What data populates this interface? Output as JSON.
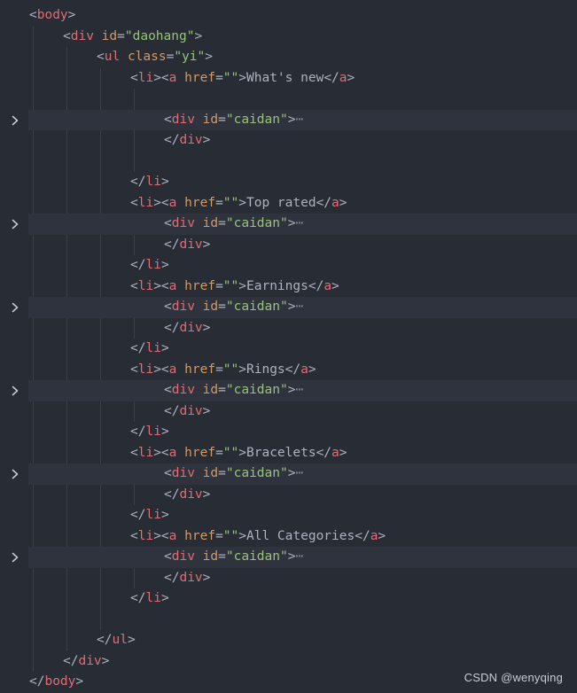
{
  "editor": {
    "watermark": "CSDN @wenyqing",
    "colors": {
      "background": "#282c34",
      "folded_line_highlight": "#2f333d",
      "tag": "#e06c75",
      "attribute": "#d19a66",
      "string": "#98c379",
      "text": "#abb2bf",
      "indent_guide": "#3b4048"
    },
    "icons": {
      "fold_marker": "chevron-right-icon"
    },
    "lines": [
      {
        "indent": 0,
        "folded": false,
        "tokens": [
          {
            "t": "punct",
            "v": "<"
          },
          {
            "t": "tag",
            "v": "body"
          },
          {
            "t": "punct",
            "v": ">"
          }
        ]
      },
      {
        "indent": 1,
        "folded": false,
        "tokens": [
          {
            "t": "punct",
            "v": "<"
          },
          {
            "t": "tag",
            "v": "div"
          },
          {
            "t": "text",
            "v": " "
          },
          {
            "t": "attr",
            "v": "id"
          },
          {
            "t": "punct",
            "v": "="
          },
          {
            "t": "str",
            "v": "\"daohang\""
          },
          {
            "t": "punct",
            "v": ">"
          }
        ]
      },
      {
        "indent": 2,
        "folded": false,
        "tokens": [
          {
            "t": "punct",
            "v": "<"
          },
          {
            "t": "tag",
            "v": "ul"
          },
          {
            "t": "text",
            "v": " "
          },
          {
            "t": "attr",
            "v": "class"
          },
          {
            "t": "punct",
            "v": "="
          },
          {
            "t": "str",
            "v": "\"yi\""
          },
          {
            "t": "punct",
            "v": ">"
          }
        ]
      },
      {
        "indent": 3,
        "folded": false,
        "tokens": [
          {
            "t": "punct",
            "v": "<"
          },
          {
            "t": "tag",
            "v": "li"
          },
          {
            "t": "punct",
            "v": "><"
          },
          {
            "t": "tag",
            "v": "a"
          },
          {
            "t": "text",
            "v": " "
          },
          {
            "t": "attr",
            "v": "href"
          },
          {
            "t": "punct",
            "v": "="
          },
          {
            "t": "str",
            "v": "\"\""
          },
          {
            "t": "punct",
            "v": ">"
          },
          {
            "t": "text",
            "v": "What's new"
          },
          {
            "t": "punct",
            "v": "</"
          },
          {
            "t": "tag",
            "v": "a"
          },
          {
            "t": "punct",
            "v": ">"
          }
        ]
      },
      {
        "indent": 0,
        "folded": false,
        "tokens": []
      },
      {
        "indent": 4,
        "folded": true,
        "tokens": [
          {
            "t": "punct",
            "v": "<"
          },
          {
            "t": "tag",
            "v": "div"
          },
          {
            "t": "text",
            "v": " "
          },
          {
            "t": "attr",
            "v": "id"
          },
          {
            "t": "punct",
            "v": "="
          },
          {
            "t": "str",
            "v": "\"caidan\""
          },
          {
            "t": "punct",
            "v": ">"
          },
          {
            "t": "ellipsis",
            "v": "⋯"
          }
        ]
      },
      {
        "indent": 4,
        "folded": false,
        "tokens": [
          {
            "t": "punct",
            "v": "</"
          },
          {
            "t": "tag",
            "v": "div"
          },
          {
            "t": "punct",
            "v": ">"
          }
        ]
      },
      {
        "indent": 0,
        "folded": false,
        "tokens": []
      },
      {
        "indent": 3,
        "folded": false,
        "tokens": [
          {
            "t": "punct",
            "v": "</"
          },
          {
            "t": "tag",
            "v": "li"
          },
          {
            "t": "punct",
            "v": ">"
          }
        ]
      },
      {
        "indent": 3,
        "folded": false,
        "tokens": [
          {
            "t": "punct",
            "v": "<"
          },
          {
            "t": "tag",
            "v": "li"
          },
          {
            "t": "punct",
            "v": "><"
          },
          {
            "t": "tag",
            "v": "a"
          },
          {
            "t": "text",
            "v": " "
          },
          {
            "t": "attr",
            "v": "href"
          },
          {
            "t": "punct",
            "v": "="
          },
          {
            "t": "str",
            "v": "\"\""
          },
          {
            "t": "punct",
            "v": ">"
          },
          {
            "t": "text",
            "v": "Top rated"
          },
          {
            "t": "punct",
            "v": "</"
          },
          {
            "t": "tag",
            "v": "a"
          },
          {
            "t": "punct",
            "v": ">"
          }
        ]
      },
      {
        "indent": 4,
        "folded": true,
        "tokens": [
          {
            "t": "punct",
            "v": "<"
          },
          {
            "t": "tag",
            "v": "div"
          },
          {
            "t": "text",
            "v": " "
          },
          {
            "t": "attr",
            "v": "id"
          },
          {
            "t": "punct",
            "v": "="
          },
          {
            "t": "str",
            "v": "\"caidan\""
          },
          {
            "t": "punct",
            "v": ">"
          },
          {
            "t": "ellipsis",
            "v": "⋯"
          }
        ]
      },
      {
        "indent": 4,
        "folded": false,
        "tokens": [
          {
            "t": "punct",
            "v": "</"
          },
          {
            "t": "tag",
            "v": "div"
          },
          {
            "t": "punct",
            "v": ">"
          }
        ]
      },
      {
        "indent": 3,
        "folded": false,
        "tokens": [
          {
            "t": "punct",
            "v": "</"
          },
          {
            "t": "tag",
            "v": "li"
          },
          {
            "t": "punct",
            "v": ">"
          }
        ]
      },
      {
        "indent": 3,
        "folded": false,
        "tokens": [
          {
            "t": "punct",
            "v": "<"
          },
          {
            "t": "tag",
            "v": "li"
          },
          {
            "t": "punct",
            "v": "><"
          },
          {
            "t": "tag",
            "v": "a"
          },
          {
            "t": "text",
            "v": " "
          },
          {
            "t": "attr",
            "v": "href"
          },
          {
            "t": "punct",
            "v": "="
          },
          {
            "t": "str",
            "v": "\"\""
          },
          {
            "t": "punct",
            "v": ">"
          },
          {
            "t": "text",
            "v": "Earnings"
          },
          {
            "t": "punct",
            "v": "</"
          },
          {
            "t": "tag",
            "v": "a"
          },
          {
            "t": "punct",
            "v": ">"
          }
        ]
      },
      {
        "indent": 4,
        "folded": true,
        "tokens": [
          {
            "t": "punct",
            "v": "<"
          },
          {
            "t": "tag",
            "v": "div"
          },
          {
            "t": "text",
            "v": " "
          },
          {
            "t": "attr",
            "v": "id"
          },
          {
            "t": "punct",
            "v": "="
          },
          {
            "t": "str",
            "v": "\"caidan\""
          },
          {
            "t": "punct",
            "v": ">"
          },
          {
            "t": "ellipsis",
            "v": "⋯"
          }
        ]
      },
      {
        "indent": 4,
        "folded": false,
        "tokens": [
          {
            "t": "punct",
            "v": "</"
          },
          {
            "t": "tag",
            "v": "div"
          },
          {
            "t": "punct",
            "v": ">"
          }
        ]
      },
      {
        "indent": 3,
        "folded": false,
        "tokens": [
          {
            "t": "punct",
            "v": "</"
          },
          {
            "t": "tag",
            "v": "li"
          },
          {
            "t": "punct",
            "v": ">"
          }
        ]
      },
      {
        "indent": 3,
        "folded": false,
        "tokens": [
          {
            "t": "punct",
            "v": "<"
          },
          {
            "t": "tag",
            "v": "li"
          },
          {
            "t": "punct",
            "v": "><"
          },
          {
            "t": "tag",
            "v": "a"
          },
          {
            "t": "text",
            "v": " "
          },
          {
            "t": "attr",
            "v": "href"
          },
          {
            "t": "punct",
            "v": "="
          },
          {
            "t": "str",
            "v": "\"\""
          },
          {
            "t": "punct",
            "v": ">"
          },
          {
            "t": "text",
            "v": "Rings"
          },
          {
            "t": "punct",
            "v": "</"
          },
          {
            "t": "tag",
            "v": "a"
          },
          {
            "t": "punct",
            "v": ">"
          }
        ]
      },
      {
        "indent": 4,
        "folded": true,
        "tokens": [
          {
            "t": "punct",
            "v": "<"
          },
          {
            "t": "tag",
            "v": "div"
          },
          {
            "t": "text",
            "v": " "
          },
          {
            "t": "attr",
            "v": "id"
          },
          {
            "t": "punct",
            "v": "="
          },
          {
            "t": "str",
            "v": "\"caidan\""
          },
          {
            "t": "punct",
            "v": ">"
          },
          {
            "t": "ellipsis",
            "v": "⋯"
          }
        ]
      },
      {
        "indent": 4,
        "folded": false,
        "tokens": [
          {
            "t": "punct",
            "v": "</"
          },
          {
            "t": "tag",
            "v": "div"
          },
          {
            "t": "punct",
            "v": ">"
          }
        ]
      },
      {
        "indent": 3,
        "folded": false,
        "tokens": [
          {
            "t": "punct",
            "v": "</"
          },
          {
            "t": "tag",
            "v": "li"
          },
          {
            "t": "punct",
            "v": ">"
          }
        ]
      },
      {
        "indent": 3,
        "folded": false,
        "tokens": [
          {
            "t": "punct",
            "v": "<"
          },
          {
            "t": "tag",
            "v": "li"
          },
          {
            "t": "punct",
            "v": "><"
          },
          {
            "t": "tag",
            "v": "a"
          },
          {
            "t": "text",
            "v": " "
          },
          {
            "t": "attr",
            "v": "href"
          },
          {
            "t": "punct",
            "v": "="
          },
          {
            "t": "str",
            "v": "\"\""
          },
          {
            "t": "punct",
            "v": ">"
          },
          {
            "t": "text",
            "v": "Bracelets"
          },
          {
            "t": "punct",
            "v": "</"
          },
          {
            "t": "tag",
            "v": "a"
          },
          {
            "t": "punct",
            "v": ">"
          }
        ]
      },
      {
        "indent": 4,
        "folded": true,
        "tokens": [
          {
            "t": "punct",
            "v": "<"
          },
          {
            "t": "tag",
            "v": "div"
          },
          {
            "t": "text",
            "v": " "
          },
          {
            "t": "attr",
            "v": "id"
          },
          {
            "t": "punct",
            "v": "="
          },
          {
            "t": "str",
            "v": "\"caidan\""
          },
          {
            "t": "punct",
            "v": ">"
          },
          {
            "t": "ellipsis",
            "v": "⋯"
          }
        ]
      },
      {
        "indent": 4,
        "folded": false,
        "tokens": [
          {
            "t": "punct",
            "v": "</"
          },
          {
            "t": "tag",
            "v": "div"
          },
          {
            "t": "punct",
            "v": ">"
          }
        ]
      },
      {
        "indent": 3,
        "folded": false,
        "tokens": [
          {
            "t": "punct",
            "v": "</"
          },
          {
            "t": "tag",
            "v": "li"
          },
          {
            "t": "punct",
            "v": ">"
          }
        ]
      },
      {
        "indent": 3,
        "folded": false,
        "tokens": [
          {
            "t": "punct",
            "v": "<"
          },
          {
            "t": "tag",
            "v": "li"
          },
          {
            "t": "punct",
            "v": "><"
          },
          {
            "t": "tag",
            "v": "a"
          },
          {
            "t": "text",
            "v": " "
          },
          {
            "t": "attr",
            "v": "href"
          },
          {
            "t": "punct",
            "v": "="
          },
          {
            "t": "str",
            "v": "\"\""
          },
          {
            "t": "punct",
            "v": ">"
          },
          {
            "t": "text",
            "v": "All Categories"
          },
          {
            "t": "punct",
            "v": "</"
          },
          {
            "t": "tag",
            "v": "a"
          },
          {
            "t": "punct",
            "v": ">"
          }
        ]
      },
      {
        "indent": 4,
        "folded": true,
        "tokens": [
          {
            "t": "punct",
            "v": "<"
          },
          {
            "t": "tag",
            "v": "div"
          },
          {
            "t": "text",
            "v": " "
          },
          {
            "t": "attr",
            "v": "id"
          },
          {
            "t": "punct",
            "v": "="
          },
          {
            "t": "str",
            "v": "\"caidan\""
          },
          {
            "t": "punct",
            "v": ">"
          },
          {
            "t": "ellipsis",
            "v": "⋯"
          }
        ]
      },
      {
        "indent": 4,
        "folded": false,
        "tokens": [
          {
            "t": "punct",
            "v": "</"
          },
          {
            "t": "tag",
            "v": "div"
          },
          {
            "t": "punct",
            "v": ">"
          }
        ]
      },
      {
        "indent": 3,
        "folded": false,
        "tokens": [
          {
            "t": "punct",
            "v": "</"
          },
          {
            "t": "tag",
            "v": "li"
          },
          {
            "t": "punct",
            "v": ">"
          }
        ]
      },
      {
        "indent": 0,
        "folded": false,
        "tokens": []
      },
      {
        "indent": 2,
        "folded": false,
        "tokens": [
          {
            "t": "punct",
            "v": "</"
          },
          {
            "t": "tag",
            "v": "ul"
          },
          {
            "t": "punct",
            "v": ">"
          }
        ]
      },
      {
        "indent": 1,
        "folded": false,
        "tokens": [
          {
            "t": "punct",
            "v": "</"
          },
          {
            "t": "tag",
            "v": "div"
          },
          {
            "t": "punct",
            "v": ">"
          }
        ]
      },
      {
        "indent": 0,
        "folded": false,
        "tokens": [
          {
            "t": "punct",
            "v": "</"
          },
          {
            "t": "tag",
            "v": "body"
          },
          {
            "t": "punct",
            "v": ">"
          }
        ]
      }
    ]
  }
}
